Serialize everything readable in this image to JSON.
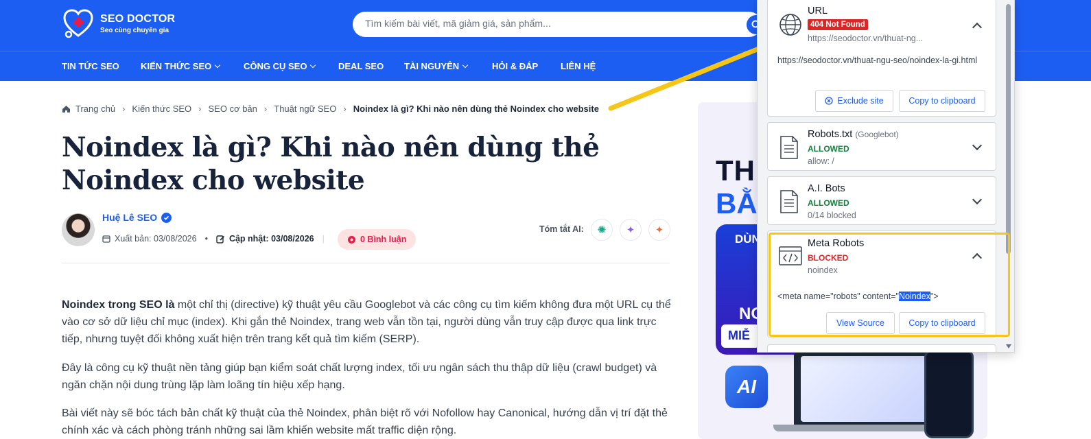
{
  "brand": {
    "name": "SEO DOCTOR",
    "tagline": "Seo cùng chuyên gia",
    "color": "#1d5ef2"
  },
  "search": {
    "placeholder": "Tìm kiếm bài viết, mã giảm giá, sản phẩm..."
  },
  "nav": [
    {
      "label": "TIN TỨC SEO",
      "dropdown": false
    },
    {
      "label": "KIẾN THỨC SEO",
      "dropdown": true
    },
    {
      "label": "CÔNG CỤ SEO",
      "dropdown": true
    },
    {
      "label": "DEAL SEO",
      "dropdown": false
    },
    {
      "label": "TÀI NGUYÊN",
      "dropdown": true
    },
    {
      "label": "HỎI & ĐÁP",
      "dropdown": false
    },
    {
      "label": "LIÊN HỆ",
      "dropdown": false
    }
  ],
  "breadcrumb": [
    "Trang chủ",
    "Kiến thức SEO",
    "SEO cơ bản",
    "Thuật ngữ SEO",
    "Noindex là gì? Khi nào nên dùng thẻ Noindex cho website"
  ],
  "article": {
    "title": "Noindex là gì? Khi nào nên dùng thẻ Noindex cho website",
    "author": "Huệ Lê SEO",
    "published_label": "Xuất bản:",
    "published": "03/08/2026",
    "updated_label": "Cập nhật:",
    "updated": "03/08/2026",
    "comments": "0 Bình luận",
    "ai_summary_label": "Tóm tắt AI:",
    "p1_bold": "Noindex trong SEO là",
    "p1_rest": " một chỉ thị (directive) kỹ thuật yêu cầu Googlebot và các công cụ tìm kiếm không đưa một URL cụ thể vào cơ sở dữ liệu chỉ mục (index). Khi gắn thẻ Noindex, trang web vẫn tồn tại, người dùng vẫn truy cập được qua link trực tiếp, nhưng tuyệt đối không xuất hiện trên trang kết quả tìm kiếm (SERP).",
    "p2": "Đây là công cụ kỹ thuật nền tảng giúp bạn kiểm soát chất lượng index, tối ưu ngân sách thu thập dữ liệu (crawl budget) và ngăn chặn nội dung trùng lặp làm loãng tín hiệu xếp hạng.",
    "p3": "Bài viết này sẽ bóc tách bản chất kỹ thuật của thẻ Noindex, phân biệt rõ với Nofollow hay Canonical, hướng dẫn vị trí đặt thẻ chính xác và cách phòng tránh những sai lầm khiến website mất traffic diện rộng."
  },
  "banner": {
    "line1": "THI",
    "line2": "BẰ",
    "line3": "DÙN",
    "line4": "NG",
    "line5": "MIỄ",
    "ai": "AI"
  },
  "extension": {
    "url_card": {
      "label": "URL",
      "badge": "404 Not Found",
      "short_url": "https://seodoctor.vn/thuat-ng...",
      "full_url": "https://seodoctor.vn/thuat-ngu-seo/noindex-la-gi.html",
      "btn_exclude": "Exclude site",
      "btn_copy": "Copy to clipboard"
    },
    "robots_card": {
      "label": "Robots.txt",
      "sub": "(Googlebot)",
      "status": "ALLOWED",
      "detail": "allow: /"
    },
    "ai_card": {
      "label": "A.I. Bots",
      "status": "ALLOWED",
      "detail": "0/14 blocked"
    },
    "meta_card": {
      "label": "Meta Robots",
      "status": "BLOCKED",
      "detail": "noindex",
      "code_before": "<meta name=\"robots\" content=\"",
      "code_highlight": "Noindex",
      "code_after": "\">",
      "btn_view": "View Source",
      "btn_copy": "Copy to clipboard"
    },
    "colors": {
      "allowed": "#15803d",
      "blocked": "#dc2626",
      "annotation": "#f5c518"
    }
  }
}
